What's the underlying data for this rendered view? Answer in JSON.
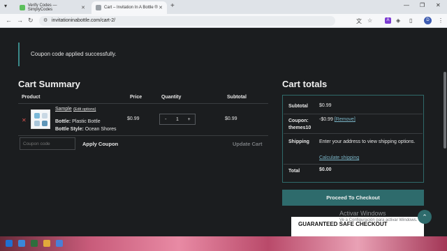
{
  "browser": {
    "tabs": [
      {
        "title": "Verify Codes — SimplyCodes",
        "active": false,
        "favicon_color": "#5bbf5b"
      },
      {
        "title": "Cart – Invitation In A Bottle ®",
        "active": true,
        "favicon_color": "#9aa0a6"
      }
    ],
    "url": "invitationinabottle.com/cart-2/",
    "profile_initial": "D",
    "extension_label": "A"
  },
  "notice": {
    "message": "Coupon code applied successfully."
  },
  "cart": {
    "heading": "Cart Summary",
    "columns": {
      "product": "Product",
      "price": "Price",
      "quantity": "Quantity",
      "subtotal": "Subtotal"
    },
    "items": [
      {
        "name": "Sample",
        "edit_label": "(Edit options)",
        "attr1_label": "Bottle:",
        "attr1_value": "Plastic Bottle",
        "attr2_label": "Bottle Style:",
        "attr2_value": "Ocean Shores",
        "price": "$0.99",
        "quantity": "1",
        "subtotal": "$0.99"
      }
    ],
    "coupon_placeholder": "Coupon code",
    "apply_label": "Apply Coupon",
    "update_label": "Update Cart"
  },
  "totals": {
    "heading": "Cart totals",
    "subtotal_label": "Subtotal",
    "subtotal_value": "$0.99",
    "coupon_label": "Coupon: themes10",
    "coupon_value": "-$0.99",
    "coupon_remove": "[Remove]",
    "shipping_label": "Shipping",
    "shipping_text": "Enter your address to view shipping options.",
    "shipping_link": "Calculate shipping",
    "total_label": "Total",
    "total_value": "$0.00"
  },
  "checkout_label": "Proceed To Checkout",
  "safe_checkout_title": "GUARANTEED SAFE CHECKOUT",
  "windows_watermark": {
    "line1": "Activar Windows",
    "line2": "Ve a Configuración para activar Windows."
  }
}
